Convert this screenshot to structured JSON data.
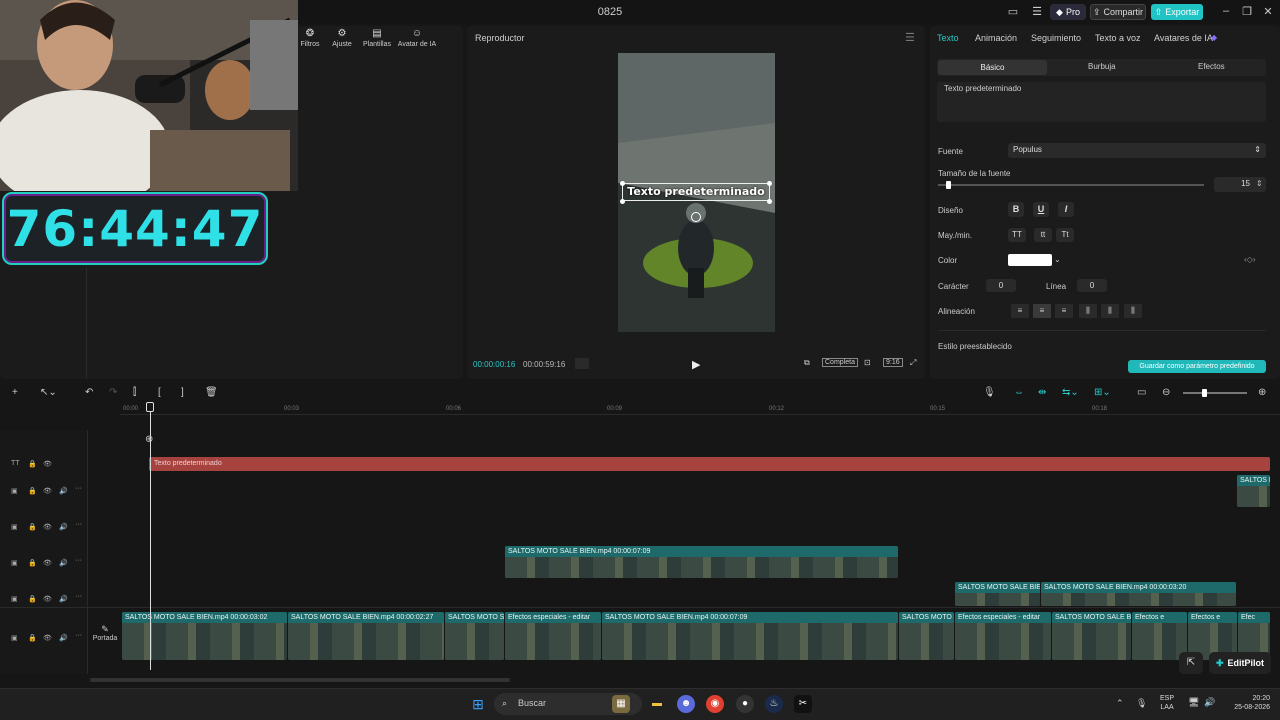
{
  "titlebar": {
    "app_title": "0825",
    "pro_label": "Pro",
    "share_label": "Compartir",
    "export_label": "Exportar"
  },
  "left_panel": {
    "tools": [
      "Filtros",
      "Ajuste",
      "Plantillas",
      "Avatar de IA"
    ]
  },
  "overlay": {
    "timer": "76:44:47"
  },
  "player": {
    "title": "Reproductor",
    "overlay_text": "Texto predeterminado",
    "current_time": "00:00:00:16",
    "total_time": "00:00:59:16",
    "full_label": "Completa",
    "ratio_label": "9:16"
  },
  "right_panel": {
    "tabs": [
      "Texto",
      "Animación",
      "Seguimiento",
      "Texto a voz",
      "Avatares de IA"
    ],
    "subtabs": [
      "Básico",
      "Burbuja",
      "Efectos"
    ],
    "text_value": "Texto predeterminado",
    "font_label": "Fuente",
    "font_value": "Populus",
    "size_label": "Tamaño de la fuente",
    "size_value": "15",
    "design_label": "Diseño",
    "format_buttons": [
      "B",
      "U",
      "I"
    ],
    "case_label": "May./min.",
    "case_buttons": [
      "TT",
      "tt",
      "Tt"
    ],
    "color_label": "Color",
    "color_value": "#ffffff",
    "char_label": "Carácter",
    "char_value": "0",
    "line_label": "Línea",
    "line_value": "0",
    "align_label": "Alineación",
    "preset_label": "Estilo preestablecido",
    "save_preset_label": "Guardar como parámetro predefinido"
  },
  "timeline": {
    "ticks": [
      "00:00",
      "00:03",
      "00:06",
      "00:09",
      "00:12",
      "00:15",
      "00:18"
    ],
    "text_clip": "Texto predeterminado",
    "cover_label": "Portada",
    "clips": {
      "right_top": "SALTOS M",
      "mid": "SALTOS MOTO SALE BIEN.mp4   00:00:07:09",
      "upper_right_a": "SALTOS MOTO SALE BIEN",
      "upper_right_b": "SALTOS MOTO SALE BIEN.mp4   00:00:03:20",
      "main": [
        "SALTOS MOTO SALE BIEN.mp4   00:00:03:02",
        "SALTOS MOTO SALE BIEN.mp4   00:00:02:27",
        "SALTOS MOTO S",
        "Efectos especiales - editar",
        "SALTOS MOTO SALE BIEN.mp4   00:00:07:09",
        "SALTOS MOTO S",
        "Efectos especiales - editar",
        "SALTOS MOTO SALE BIE",
        "Efectos e",
        "Efectos e",
        "Efec"
      ]
    },
    "editpilot_label": "EditPilot"
  },
  "taskbar": {
    "search_placeholder": "Buscar",
    "lang_line1": "ESP",
    "lang_line2": "LAA",
    "time": "20:20",
    "date": "25-08-2026"
  },
  "colors": {
    "accent": "#20c4c4",
    "text_clip": "#a7433f",
    "video_clip": "#1c5a5a",
    "timer": "#2fe0e6"
  }
}
